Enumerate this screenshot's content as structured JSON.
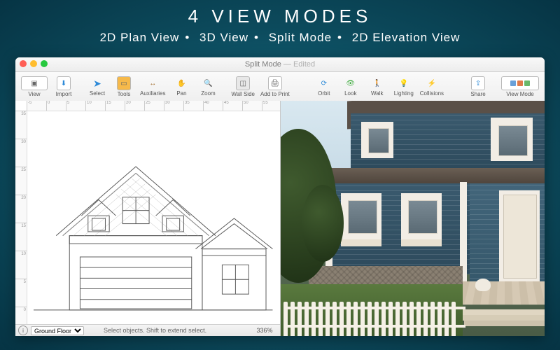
{
  "promo": {
    "title": "4 VIEW MODES",
    "modes": [
      "2D Plan View",
      "3D View",
      "Split Mode",
      "2D Elevation View"
    ]
  },
  "window": {
    "title": "Split Mode",
    "edited_suffix": " — Edited"
  },
  "toolbar": {
    "view": "View",
    "import": "Import",
    "select": "Select",
    "tools": "Tools",
    "auxiliaries": "Auxiliaries",
    "pan": "Pan",
    "zoom": "Zoom",
    "wall_side": "Wall Side",
    "add_to_print": "Add to Print",
    "orbit": "Orbit",
    "look": "Look",
    "walk": "Walk",
    "lighting": "Lighting",
    "collisions": "Collisions",
    "share": "Share",
    "view_mode": "View Mode"
  },
  "status": {
    "floor_selector": "Ground Floor",
    "zoom": "336%",
    "hint": "Select objects. Shift to extend select."
  },
  "ruler": {
    "top_ticks": [
      "-5",
      "0",
      "5",
      "10",
      "15",
      "20",
      "25",
      "30",
      "35",
      "40",
      "45",
      "50",
      "55"
    ],
    "left_ticks": [
      "35",
      "30",
      "25",
      "20",
      "15",
      "10",
      "5",
      "0"
    ]
  },
  "colors": {
    "promo_bg": "#0c4a5c",
    "siding": "#35576a",
    "trim": "#f2ede5"
  }
}
